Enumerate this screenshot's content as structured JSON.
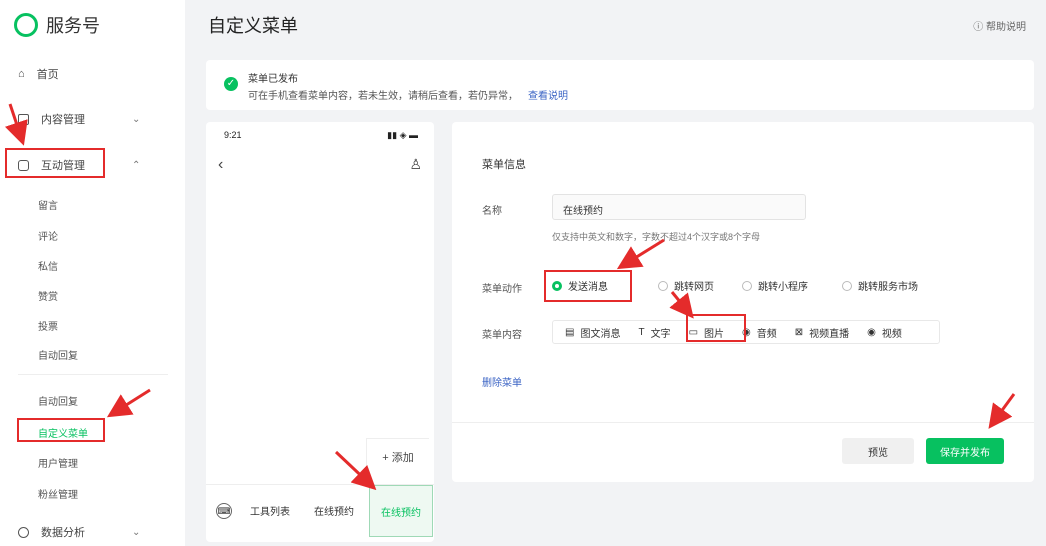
{
  "app": {
    "name": "服务号"
  },
  "page": {
    "title": "自定义菜单",
    "top_right_link": "帮助说明"
  },
  "sidebar": {
    "items": [
      {
        "label": "首页"
      },
      {
        "label": "内容管理"
      },
      {
        "label": "互动管理"
      }
    ],
    "sub_items": [
      "留言",
      "评论",
      "私信",
      "赞赏",
      "投票",
      "自动回复",
      "自动回复",
      "自定义菜单",
      "用户管理",
      "粉丝管理"
    ],
    "bottom": {
      "label": "数据分析"
    }
  },
  "notice": {
    "title": "菜单已发布",
    "desc": "可在手机查看菜单内容，若未生效，请稍后查看，若仍异常，",
    "link": "查看说明"
  },
  "phone": {
    "time": "9:21",
    "signal": "▮▮ ◈ ▬",
    "add_label": "+ 添加",
    "tabs": [
      "工具列表",
      "在线预约",
      "在线预约"
    ]
  },
  "editor": {
    "section_title": "菜单信息",
    "name_label": "名称",
    "name_value": "在线预约",
    "name_hint": "仅支持中英文和数字，字数不超过4个汉字或8个字母",
    "type_label": "菜单内容",
    "radio_label": "菜单动作",
    "radio_options": [
      "发送消息",
      "跳转网页",
      "跳转小程序",
      "跳转服务市场"
    ],
    "content_types": [
      "图文消息",
      "文字",
      "图片",
      "音频",
      "视频直播",
      "视频"
    ],
    "delete_label": "删除菜单",
    "preview_button": "预览",
    "save_button": "保存并发布"
  },
  "colors": {
    "accent": "#07c160",
    "highlight_red": "#e42b2b",
    "link_blue": "#3a63c4"
  }
}
